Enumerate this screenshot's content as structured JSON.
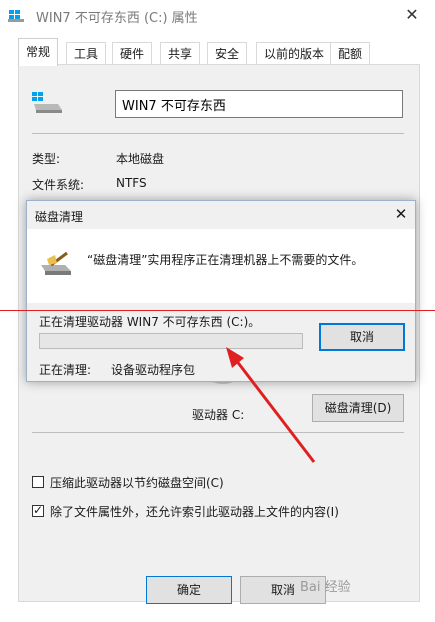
{
  "window": {
    "title": "WIN7 不可存东西 (C:) 属性"
  },
  "tabs": [
    "常规",
    "工具",
    "硬件",
    "共享",
    "安全",
    "以前的版本",
    "配额"
  ],
  "general": {
    "name_value": "WIN7 不可存东西",
    "type_label": "类型:",
    "type_value": "本地磁盘",
    "fs_label": "文件系统:",
    "fs_value": "NTFS",
    "drive_label": "驱动器 C:",
    "cleanup_button": "磁盘清理(D)",
    "compress_label": "压缩此驱动器以节约磁盘空间(C)",
    "compress_checked": false,
    "index_label": "除了文件属性外，还允许索引此驱动器上文件的内容(I)",
    "index_checked": true
  },
  "footer": {
    "ok": "确定",
    "cancel": "取消"
  },
  "dialog": {
    "title": "磁盘清理",
    "message": "“磁盘清理”实用程序正在清理机器上不需要的文件。",
    "status": "正在清理驱动器 WIN7 不可存东西 (C:)。",
    "progress": 0,
    "cancel": "取消",
    "current_label": "正在清理:",
    "current_value": "设备驱动程序包"
  },
  "watermark": "Bai 经验",
  "colors": {
    "accent": "#0078d7",
    "annotation": "#e02020"
  }
}
